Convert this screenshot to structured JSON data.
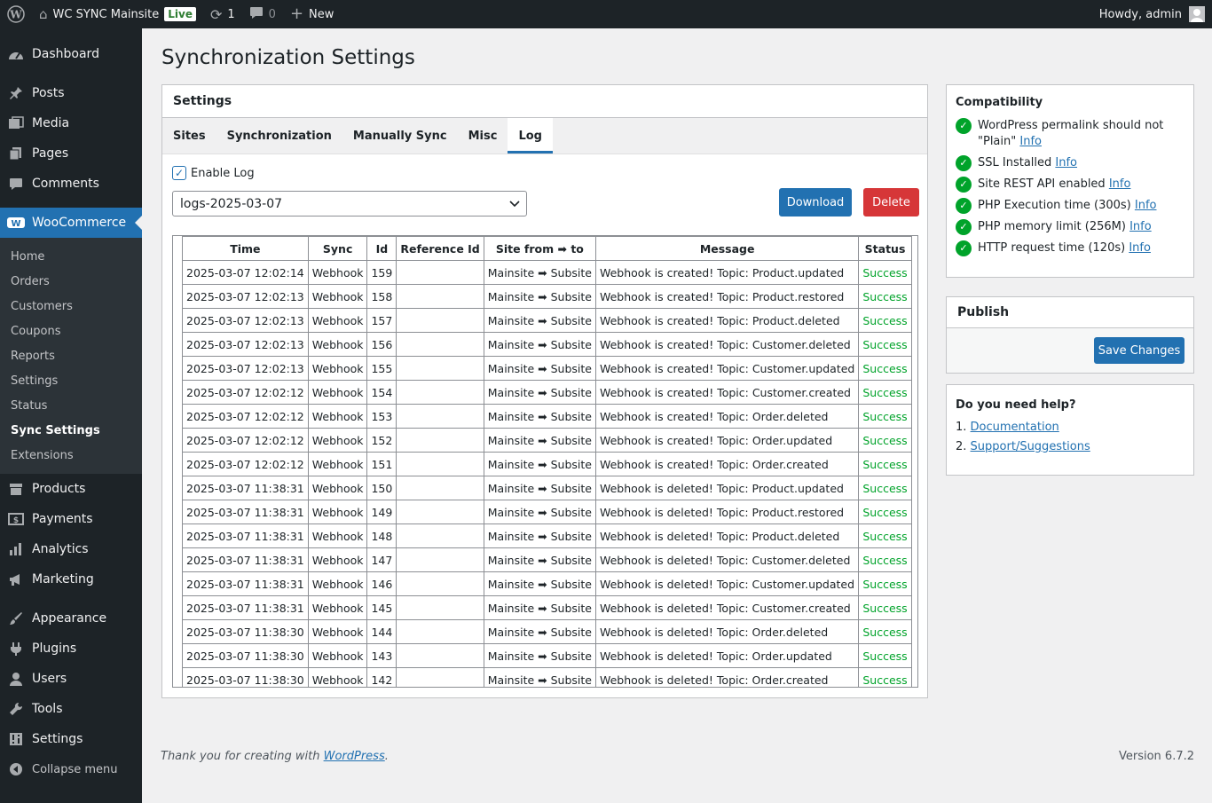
{
  "adminbar": {
    "site_name": "WC SYNC Mainsite",
    "live_badge": "Live",
    "updates_count": "1",
    "comments_count": "0",
    "new_label": "New",
    "howdy": "Howdy, admin"
  },
  "sidebar": {
    "top": [
      {
        "label": "Dashboard",
        "icon": "dashboard-icon"
      }
    ],
    "content": [
      {
        "label": "Posts",
        "icon": "pin-icon"
      },
      {
        "label": "Media",
        "icon": "media-icon"
      },
      {
        "label": "Pages",
        "icon": "pages-icon"
      },
      {
        "label": "Comments",
        "icon": "comment-icon"
      }
    ],
    "woo_label": "WooCommerce",
    "woo_sub": [
      "Home",
      "Orders",
      "Customers",
      "Coupons",
      "Reports",
      "Settings",
      "Status",
      "Sync Settings",
      "Extensions"
    ],
    "woo_more": [
      {
        "label": "Products",
        "icon": "archive-icon"
      },
      {
        "label": "Payments",
        "icon": "money-icon"
      },
      {
        "label": "Analytics",
        "icon": "bar-chart-icon"
      },
      {
        "label": "Marketing",
        "icon": "megaphone-icon"
      }
    ],
    "admin": [
      {
        "label": "Appearance",
        "icon": "brush-icon"
      },
      {
        "label": "Plugins",
        "icon": "plug-icon"
      },
      {
        "label": "Users",
        "icon": "user-icon"
      },
      {
        "label": "Tools",
        "icon": "wrench-icon"
      },
      {
        "label": "Settings",
        "icon": "sliders-icon"
      }
    ],
    "collapse": "Collapse menu"
  },
  "page": {
    "title": "Synchronization Settings",
    "panel_title": "Settings",
    "tabs": [
      "Sites",
      "Synchronization",
      "Manually Sync",
      "Misc",
      "Log"
    ],
    "enable_log": "Enable Log",
    "selected_log": "logs-2025-03-07",
    "download": "Download",
    "delete": "Delete"
  },
  "log_table": {
    "headers": [
      "Time",
      "Sync",
      "Id",
      "Reference Id",
      "Site from ➡ to",
      "Message",
      "Status"
    ],
    "rows": [
      [
        "2025-03-07 12:02:14",
        "Webhook",
        "159",
        "",
        "Mainsite ➡ Subsite",
        "Webhook is created! Topic: Product.updated",
        "Success"
      ],
      [
        "2025-03-07 12:02:13",
        "Webhook",
        "158",
        "",
        "Mainsite ➡ Subsite",
        "Webhook is created! Topic: Product.restored",
        "Success"
      ],
      [
        "2025-03-07 12:02:13",
        "Webhook",
        "157",
        "",
        "Mainsite ➡ Subsite",
        "Webhook is created! Topic: Product.deleted",
        "Success"
      ],
      [
        "2025-03-07 12:02:13",
        "Webhook",
        "156",
        "",
        "Mainsite ➡ Subsite",
        "Webhook is created! Topic: Customer.deleted",
        "Success"
      ],
      [
        "2025-03-07 12:02:13",
        "Webhook",
        "155",
        "",
        "Mainsite ➡ Subsite",
        "Webhook is created! Topic: Customer.updated",
        "Success"
      ],
      [
        "2025-03-07 12:02:12",
        "Webhook",
        "154",
        "",
        "Mainsite ➡ Subsite",
        "Webhook is created! Topic: Customer.created",
        "Success"
      ],
      [
        "2025-03-07 12:02:12",
        "Webhook",
        "153",
        "",
        "Mainsite ➡ Subsite",
        "Webhook is created! Topic: Order.deleted",
        "Success"
      ],
      [
        "2025-03-07 12:02:12",
        "Webhook",
        "152",
        "",
        "Mainsite ➡ Subsite",
        "Webhook is created! Topic: Order.updated",
        "Success"
      ],
      [
        "2025-03-07 12:02:12",
        "Webhook",
        "151",
        "",
        "Mainsite ➡ Subsite",
        "Webhook is created! Topic: Order.created",
        "Success"
      ],
      [
        "2025-03-07 11:38:31",
        "Webhook",
        "150",
        "",
        "Mainsite ➡ Subsite",
        "Webhook is deleted! Topic: Product.updated",
        "Success"
      ],
      [
        "2025-03-07 11:38:31",
        "Webhook",
        "149",
        "",
        "Mainsite ➡ Subsite",
        "Webhook is deleted! Topic: Product.restored",
        "Success"
      ],
      [
        "2025-03-07 11:38:31",
        "Webhook",
        "148",
        "",
        "Mainsite ➡ Subsite",
        "Webhook is deleted! Topic: Product.deleted",
        "Success"
      ],
      [
        "2025-03-07 11:38:31",
        "Webhook",
        "147",
        "",
        "Mainsite ➡ Subsite",
        "Webhook is deleted! Topic: Customer.deleted",
        "Success"
      ],
      [
        "2025-03-07 11:38:31",
        "Webhook",
        "146",
        "",
        "Mainsite ➡ Subsite",
        "Webhook is deleted! Topic: Customer.updated",
        "Success"
      ],
      [
        "2025-03-07 11:38:31",
        "Webhook",
        "145",
        "",
        "Mainsite ➡ Subsite",
        "Webhook is deleted! Topic: Customer.created",
        "Success"
      ],
      [
        "2025-03-07 11:38:30",
        "Webhook",
        "144",
        "",
        "Mainsite ➡ Subsite",
        "Webhook is deleted! Topic: Order.deleted",
        "Success"
      ],
      [
        "2025-03-07 11:38:30",
        "Webhook",
        "143",
        "",
        "Mainsite ➡ Subsite",
        "Webhook is deleted! Topic: Order.updated",
        "Success"
      ],
      [
        "2025-03-07 11:38:30",
        "Webhook",
        "142",
        "",
        "Mainsite ➡ Subsite",
        "Webhook is deleted! Topic: Order.created",
        "Success"
      ]
    ]
  },
  "compatibility": {
    "title": "Compatibility",
    "items": [
      {
        "text": "WordPress permalink should not \"Plain\"",
        "link": "Info"
      },
      {
        "text": "SSL Installed",
        "link": "Info"
      },
      {
        "text": "Site REST API enabled",
        "link": "Info"
      },
      {
        "text": "PHP Execution time (300s)",
        "link": "Info"
      },
      {
        "text": "PHP memory limit (256M)",
        "link": "Info"
      },
      {
        "text": "HTTP request time (120s)",
        "link": "Info"
      }
    ]
  },
  "publish": {
    "title": "Publish",
    "save": "Save Changes"
  },
  "help": {
    "title": "Do you need help?",
    "items": [
      {
        "num": "1.",
        "link": "Documentation"
      },
      {
        "num": "2.",
        "link": "Support/Suggestions"
      }
    ]
  },
  "footer": {
    "text": "Thank you for creating with",
    "link": "WordPress",
    "version": "Version 6.7.2"
  },
  "colors": {
    "accent": "#2271b1",
    "danger": "#d63638",
    "success": "#00a32a",
    "sidebar_bg": "#1d2327"
  }
}
